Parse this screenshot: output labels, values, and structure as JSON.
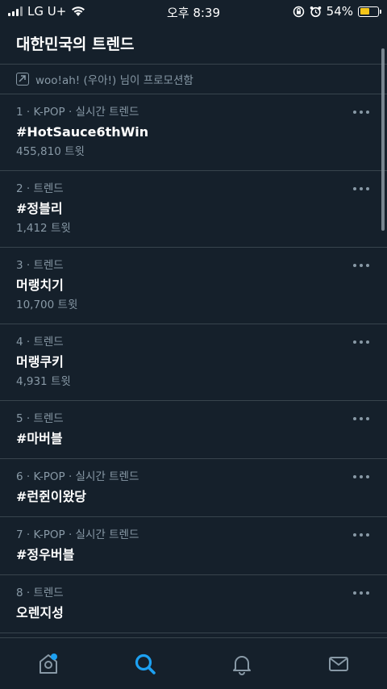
{
  "status": {
    "carrier": "LG U+",
    "time": "오후 8:39",
    "battery": "54%",
    "battery_level": 0.54
  },
  "header": {
    "title": "대한민국의 트렌드"
  },
  "promo": {
    "text": "woo!ah! (우아!) 님이 프로모션함"
  },
  "trends": [
    {
      "meta": "1 · K-POP · 실시간 트렌드",
      "name": "#HotSauce6thWin",
      "count": "455,810 트윗"
    },
    {
      "meta": "2 · 트렌드",
      "name": "#정블리",
      "count": "1,412 트윗"
    },
    {
      "meta": "3 · 트렌드",
      "name": "머랭치기",
      "count": "10,700 트윗"
    },
    {
      "meta": "4 · 트렌드",
      "name": "머랭쿠키",
      "count": "4,931 트윗"
    },
    {
      "meta": "5 · 트렌드",
      "name": "#마버블",
      "count": ""
    },
    {
      "meta": "6 · K-POP · 실시간 트렌드",
      "name": "#런쥔이왔당",
      "count": ""
    },
    {
      "meta": "7 · K-POP · 실시간 트렌드",
      "name": "#정우버블",
      "count": ""
    },
    {
      "meta": "8 · 트렌드",
      "name": "오렌지성",
      "count": ""
    }
  ],
  "tabs": [
    "home-icon",
    "search-icon",
    "notifications-icon",
    "messages-icon"
  ],
  "colors": {
    "background": "#15202b",
    "accent": "#1da1f2",
    "muted": "#8899a6"
  }
}
